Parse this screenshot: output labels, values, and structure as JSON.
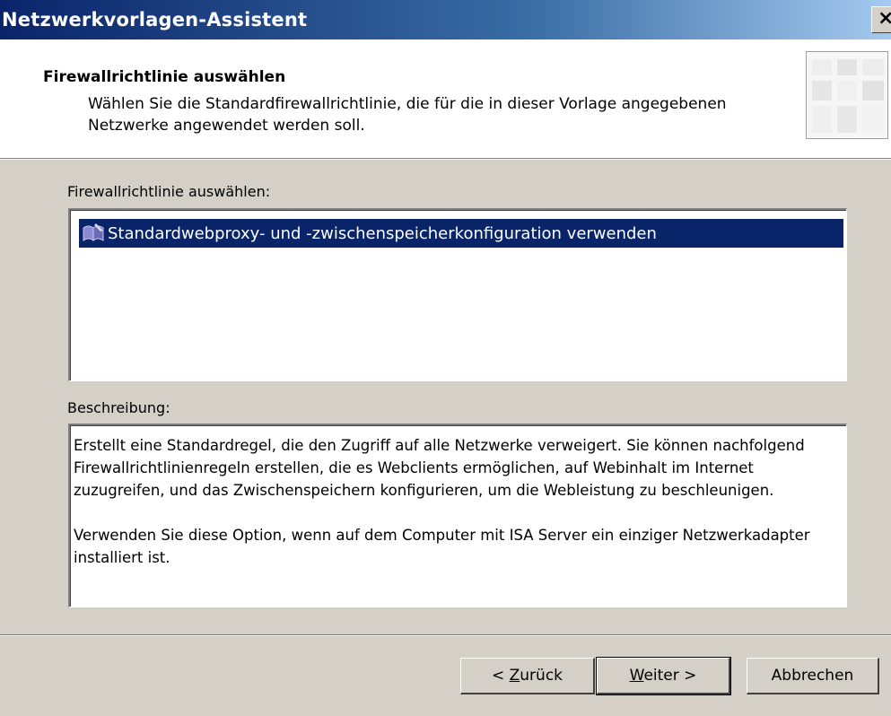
{
  "window": {
    "title": "Netzwerkvorlagen-Assistent",
    "close_label": "×"
  },
  "header": {
    "title": "Firewallrichtlinie auswählen",
    "subtitle": "Wählen Sie die Standardfirewallrichtlinie, die für die in dieser Vorlage angegebenen Netzwerke angewendet werden soll."
  },
  "policy_list": {
    "label": "Firewallrichtlinie auswählen:",
    "items": [
      {
        "label": "Standardwebproxy- und -zwischenspeicherkonfiguration verwenden",
        "selected": true,
        "icon": "firewall-policy-icon"
      }
    ]
  },
  "description": {
    "label": "Beschreibung:",
    "paragraphs": [
      "Erstellt eine Standardregel, die den Zugriff auf alle Netzwerke verweigert. Sie können nachfolgend Firewallrichtlinienregeln erstellen, die es Webclients ermöglichen, auf Webinhalt im Internet zuzugreifen, und das Zwischenspeichern konfigurieren, um die Webleistung zu beschleunigen.",
      "Verwenden Sie diese Option, wenn auf dem Computer mit ISA Server ein einziger Netzwerkadapter installiert ist."
    ]
  },
  "buttons": {
    "back_prefix": "< ",
    "back_mnemonic": "Z",
    "back_rest": "urück",
    "next_mnemonic": "W",
    "next_rest": "eiter >",
    "cancel": "Abbrechen"
  },
  "colors": {
    "title_bar": "#0a246a",
    "selection": "#0a246a",
    "dialog_face": "#d4d0c8"
  }
}
